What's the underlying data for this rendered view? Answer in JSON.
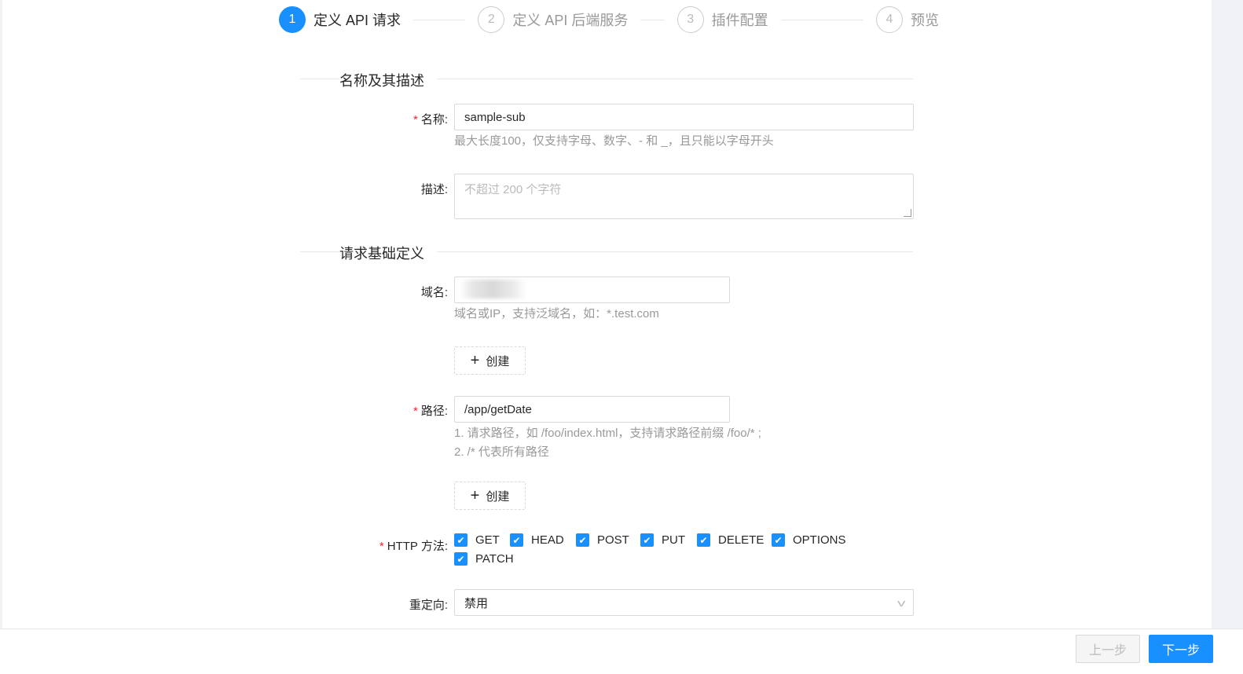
{
  "steps": [
    {
      "num": "1",
      "title": "定义 API 请求"
    },
    {
      "num": "2",
      "title": "定义 API 后端服务"
    },
    {
      "num": "3",
      "title": "插件配置"
    },
    {
      "num": "4",
      "title": "预览"
    }
  ],
  "sections": {
    "basic": "名称及其描述",
    "request": "请求基础定义"
  },
  "form": {
    "name": {
      "label": "名称:",
      "value": "sample-sub",
      "help": "最大长度100，仅支持字母、数字、- 和 _，且只能以字母开头"
    },
    "desc": {
      "label": "描述:",
      "placeholder": "不超过 200 个字符"
    },
    "domain": {
      "label": "域名:",
      "help": "域名或IP，支持泛域名，如：*.test.com",
      "create": "创建"
    },
    "path": {
      "label": "路径:",
      "value": "/app/getDate",
      "help1": "1. 请求路径，如 /foo/index.html，支持请求路径前缀 /foo/* ;",
      "help2": "2. /* 代表所有路径",
      "create": "创建"
    },
    "methods": {
      "label": "HTTP 方法:",
      "options": [
        "GET",
        "HEAD",
        "POST",
        "PUT",
        "DELETE",
        "OPTIONS",
        "PATCH"
      ]
    },
    "redirect": {
      "label": "重定向:",
      "value": "禁用"
    }
  },
  "footer": {
    "prev": "上一步",
    "next": "下一步"
  },
  "colors": {
    "primary": "#1890ff",
    "required": "#f5222d"
  }
}
